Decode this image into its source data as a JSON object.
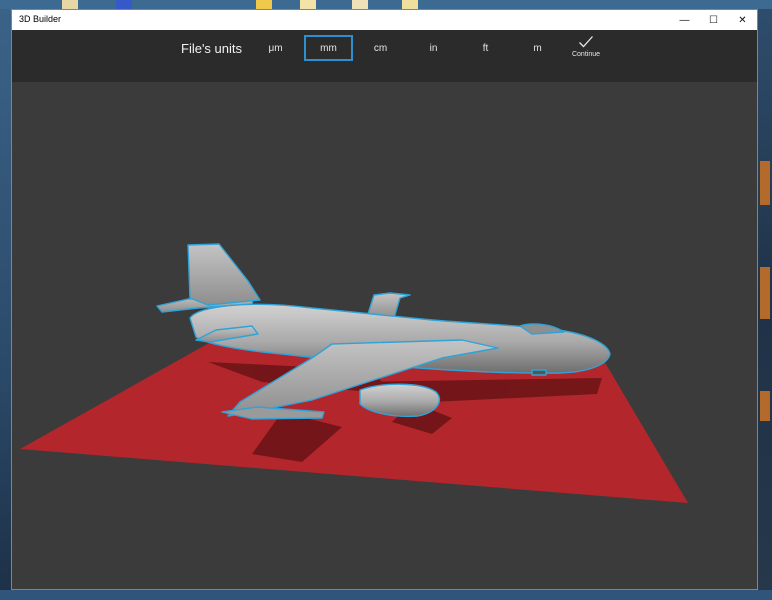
{
  "window": {
    "title": "3D Builder"
  },
  "controls": {
    "minimize": "—",
    "maximize": "☐",
    "close": "✕"
  },
  "toolbar": {
    "units_label": "File's units",
    "units": [
      "μm",
      "mm",
      "cm",
      "in",
      "ft",
      "m"
    ],
    "selected_unit": "mm",
    "continue_label": "Continue"
  },
  "colors": {
    "accent": "#2e8fd0",
    "platform": "#b3262c",
    "model": "#a8a8a8",
    "outline": "#2fa3d8"
  },
  "icons": {
    "continue": "checkmark-icon",
    "model": "airplane-model"
  }
}
